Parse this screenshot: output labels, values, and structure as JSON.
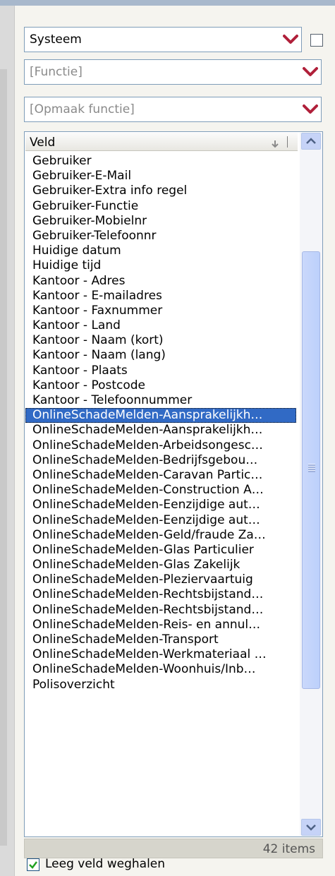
{
  "combos": {
    "system": {
      "value": "Systeem"
    },
    "function": {
      "placeholder": "[Functie]"
    },
    "format_function": {
      "placeholder": "[Opmaak functie]"
    }
  },
  "list": {
    "header": "Veld",
    "items": [
      "Gebruiker",
      "Gebruiker-E-Mail",
      "Gebruiker-Extra info regel",
      "Gebruiker-Functie",
      "Gebruiker-Mobielnr",
      "Gebruiker-Telefoonnr",
      "Huidige datum",
      "Huidige tijd",
      "Kantoor - Adres",
      "Kantoor - E-mailadres",
      "Kantoor - Faxnummer",
      "Kantoor - Land",
      "Kantoor - Naam (kort)",
      "Kantoor - Naam (lang)",
      "Kantoor - Plaats",
      "Kantoor - Postcode",
      "Kantoor - Telefoonnummer",
      "OnlineSchadeMelden-Aansprakelijkh…",
      "OnlineSchadeMelden-Aansprakelijkh…",
      "OnlineSchadeMelden-Arbeidsongesc…",
      "OnlineSchadeMelden-Bedrijfsgebou…",
      "OnlineSchadeMelden-Caravan Partic…",
      "OnlineSchadeMelden-Construction A…",
      "OnlineSchadeMelden-Eenzijdige aut…",
      "OnlineSchadeMelden-Eenzijdige aut…",
      "OnlineSchadeMelden-Geld/fraude Za…",
      "OnlineSchadeMelden-Glas Particulier",
      "OnlineSchadeMelden-Glas Zakelijk",
      "OnlineSchadeMelden-Pleziervaartuig",
      "OnlineSchadeMelden-Rechtsbijstand…",
      "OnlineSchadeMelden-Rechtsbijstand…",
      "OnlineSchadeMelden-Reis- en annul…",
      "OnlineSchadeMelden-Transport",
      "OnlineSchadeMelden-Werkmateriaal …",
      "OnlineSchadeMelden-Woonhuis/Inb…",
      "Polisoverzicht"
    ],
    "selected_index": 17,
    "count_label": "42 items"
  },
  "options": {
    "remove_empty_field_label": "Leeg veld weghalen",
    "remove_empty_field_checked": true
  },
  "icons": {
    "combo_arrow": "chevron-down-icon",
    "sort": "sort-arrow-icon",
    "scroll_up": "chevron-up-icon",
    "scroll_down": "chevron-down-icon",
    "check": "checkmark-icon"
  },
  "colors": {
    "selection": "#316ac5",
    "combo_arrow": "#b0203a",
    "border": "#7f9db9"
  }
}
